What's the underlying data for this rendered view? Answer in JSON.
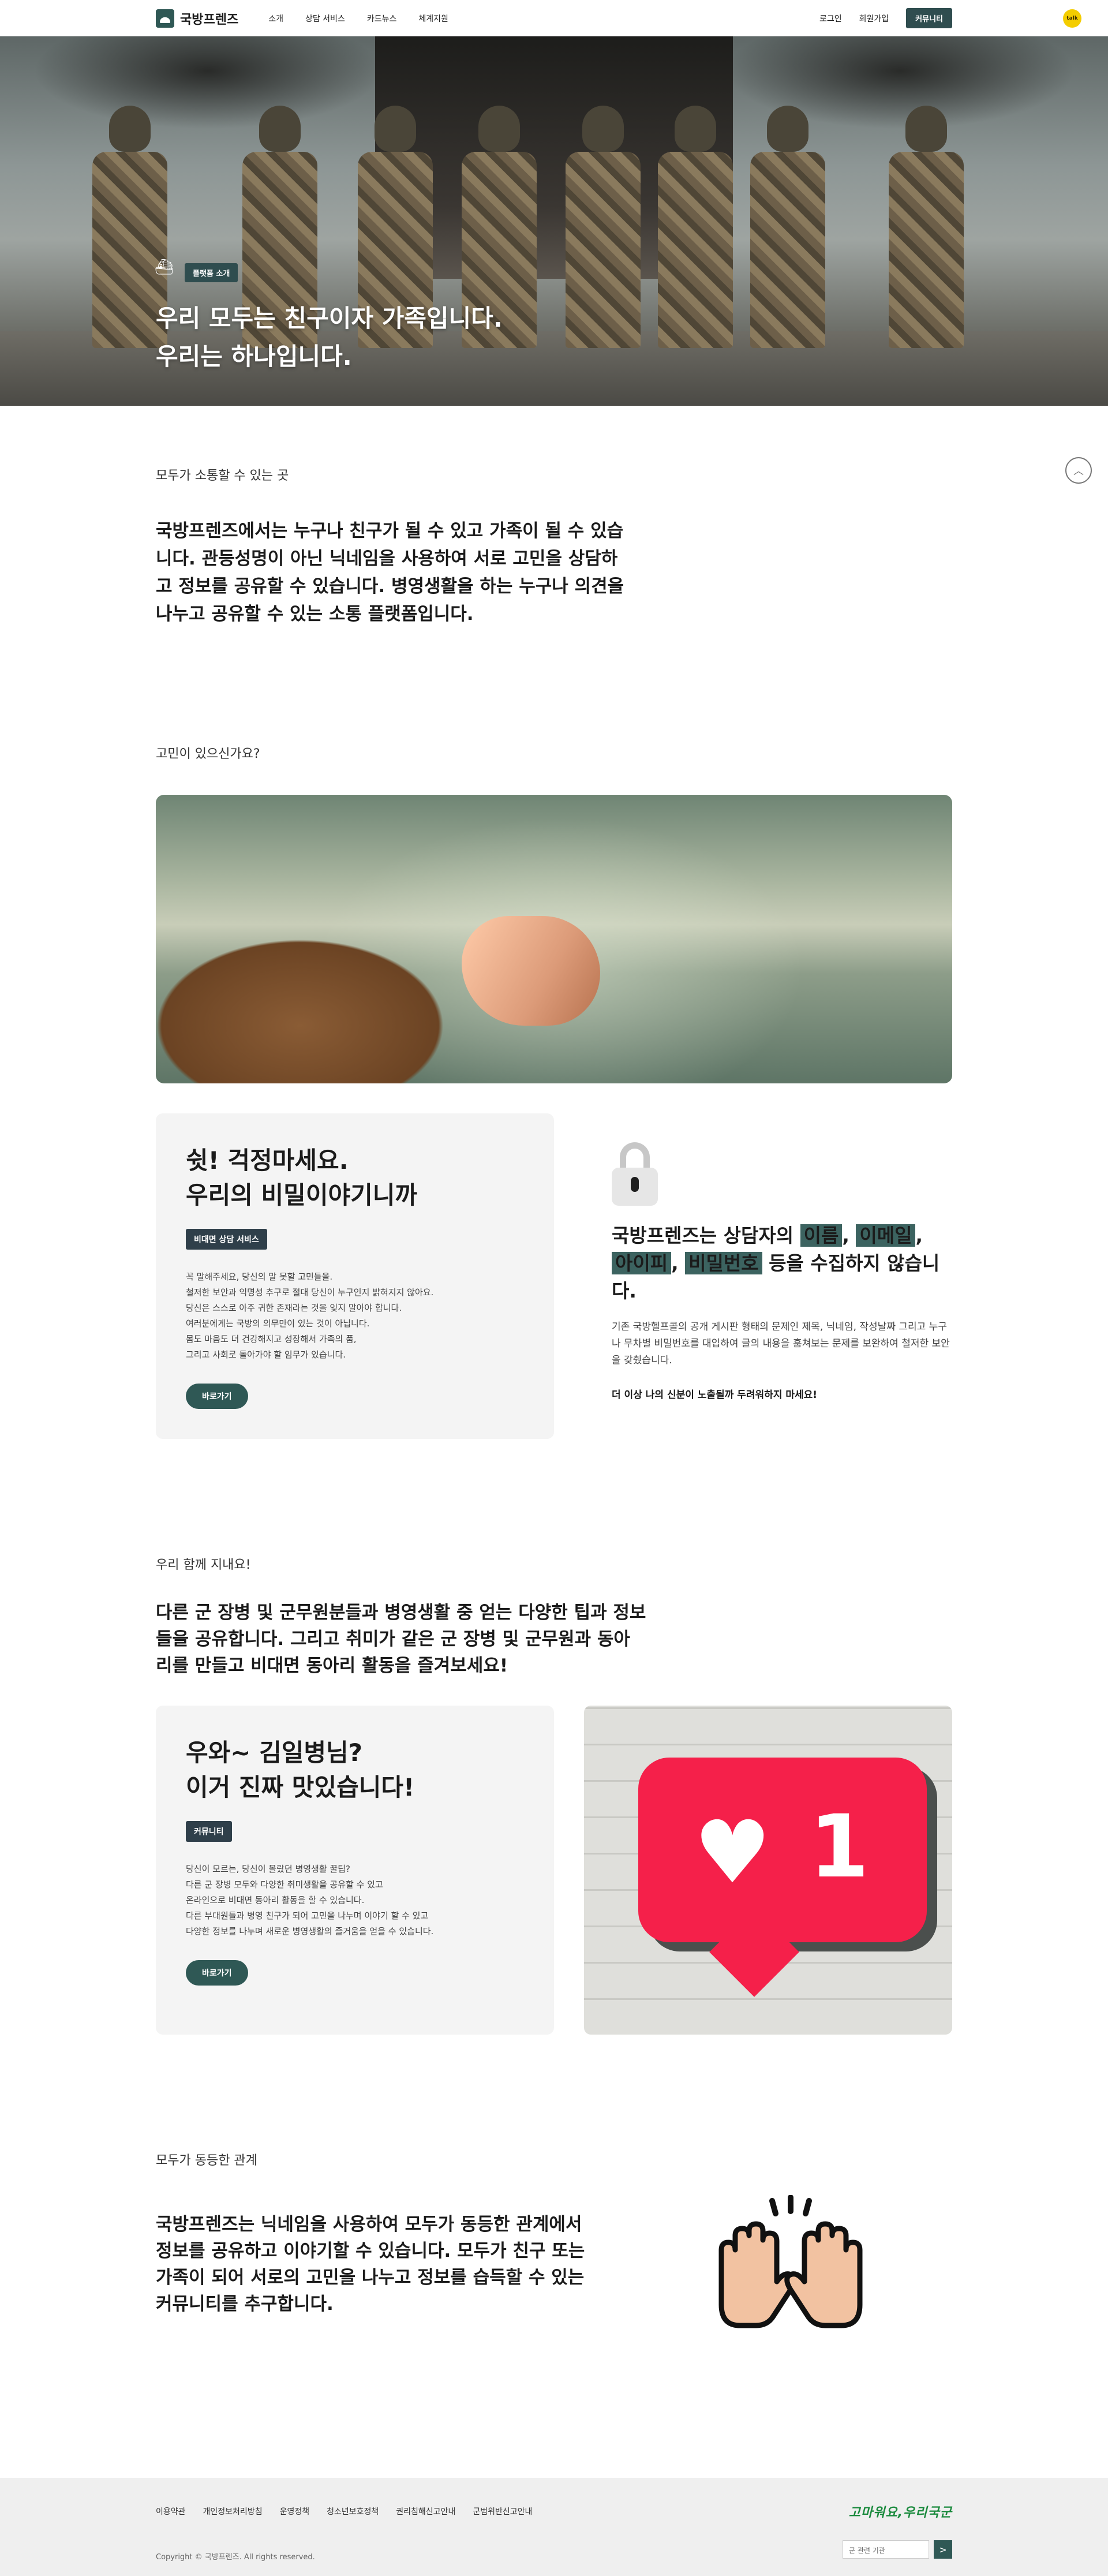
{
  "header": {
    "logo_text": "국방프렌즈",
    "nav": [
      "소개",
      "상담 서비스",
      "카드뉴스",
      "체계지원"
    ],
    "login": "로그인",
    "signup": "회원가입",
    "community": "커뮤니티",
    "kakao": "talk"
  },
  "hero": {
    "badge": "플랫폼 소개",
    "title_line1": "우리 모두는 친구이자 가족입니다.",
    "title_line2": "우리는 하나입니다."
  },
  "section1": {
    "label": "모두가 소통할 수 있는 곳",
    "lead": "국방프렌즈에서는 누구나 친구가 될 수 있고 가족이 될 수 있습니다. 관등성명이 아닌 닉네임을 사용하여 서로 고민을 상담하고 정보를 공유할 수 있습니다. 병영생활을 하는 누구나 의견을 나누고 공유할 수 있는 소통 플랫폼입니다."
  },
  "section2": {
    "label": "고민이 있으신가요?",
    "card": {
      "title_line1": "쉿! 걱정마세요.",
      "title_line2": "우리의 비밀이야기니까",
      "badge": "비대면 상담 서비스",
      "body": [
        "꼭 말해주세요, 당신의 말 못할 고민들을.",
        "철저한 보안과 익명성 추구로 절대 당신이 누구인지 밝혀지지 않아요.",
        "당신은 스스로 아주 귀한 존재라는 것을 잊지 말아야 합니다.",
        "여러분에게는 국방의 의무만이 있는 것이 아닙니다.",
        "몸도 마음도 더 건강해지고 성장해서 가족의 품,",
        "그리고 사회로 돌아가야 할 임무가 있습니다."
      ],
      "button": "바로가기"
    },
    "secret": {
      "title_a": "국방프렌즈는 상담자의 ",
      "hl1": "이름",
      "sep1": ", ",
      "hl2": "이메일",
      "sep2": ",",
      "hl3": "아이피",
      "sep3": ", ",
      "hl4": "비밀번호",
      "title_b": " 등을 수집하지 않습니다.",
      "body": "기존 국방헬프콜의 공개 게시판 형태의 문제인 제목, 닉네임, 작성날짜 그리고 누구나 무차별 비밀번호를 대입하여 글의 내용을 훔쳐보는 문제를 보완하여 철저한 보안을 갖췄습니다.",
      "note": "더 이상 나의 신분이 노출될까 두려워하지 마세요!"
    }
  },
  "section3": {
    "label": "우리 함께 지내요!",
    "lead": "다른 군 장병 및 군무원분들과 병영생활 중 얻는 다양한 팁과 정보들을 공유합니다. 그리고 취미가 같은 군 장병 및 군무원과 동아리를 만들고 비대면 동아리 활동을 즐겨보세요!",
    "card": {
      "title_line1": "우와~ 김일병님?",
      "title_line2": "이거 진짜 맛있습니다!",
      "badge": "커뮤니티",
      "body": [
        "당신이 모르는, 당신이 몰랐던 병영생활 꿀팁?",
        "다른 군 장병 모두와 다양한 취미생활을 공유할 수 있고",
        "온라인으로 비대면 동아리 활동을 할 수 있습니다.",
        "다른 부대원들과 병영 친구가 되어 고민을 나누며 이야기 할 수 있고",
        "다양한 정보를 나누며 새로운 병영생활의 즐거움을 얻을 수 있습니다."
      ],
      "button": "바로가기"
    },
    "like_count": "1"
  },
  "section4": {
    "label": "모두가 동등한 관계",
    "lead": "국방프렌즈는 닉네임을 사용하여 모두가 동등한 관계에서 정보를 공유하고 이야기할 수 있습니다. 모두가 친구 또는 가족이 되어 서로의 고민을 나누고 정보를 습득할 수 있는 커뮤니티를 추구합니다."
  },
  "footer": {
    "links": [
      "이용약관",
      "개인정보처리방침",
      "운영정책",
      "청소년보호정책",
      "권리침해신고안내",
      "군범위반신고안내"
    ],
    "copyright": "Copyright © 국방프렌즈. All rights reserved.",
    "logo_text": "고마워요,우리국군",
    "select_placeholder": "군 관련 기관",
    "go_label": ">"
  }
}
